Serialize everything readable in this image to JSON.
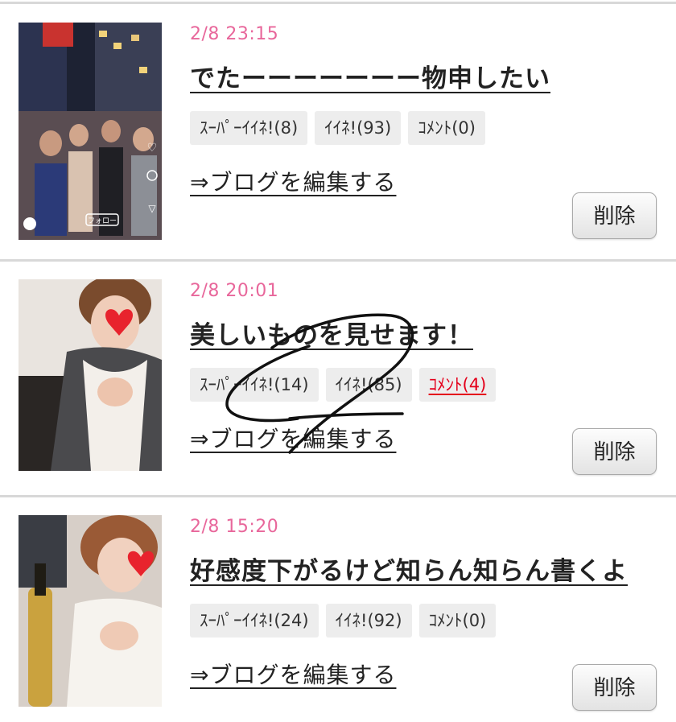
{
  "posts": [
    {
      "date": "2/8 23:15",
      "title": "でたーーーーーーー物申したい",
      "super_like": "ｽｰﾊﾟｰｲｲﾈ!(8)",
      "like": "ｲｲﾈ!(93)",
      "comment": "ｺﾒﾝﾄ(0)",
      "edit_link": "⇒ブログを編集する",
      "delete_label": "削除",
      "thumb_overlay": "フォロー"
    },
    {
      "date": "2/8 20:01",
      "title": "美しいものを見せます！",
      "super_like": "ｽｰﾊﾟｰｲｲﾈ!(14)",
      "like": "ｲｲﾈ!(85)",
      "comment": "ｺﾒﾝﾄ(4)",
      "edit_link": "⇒ブログを編集する",
      "delete_label": "削除"
    },
    {
      "date": "2/8 15:20",
      "title": "好感度下がるけど知らん知らん書くよ",
      "super_like": "ｽｰﾊﾟｰｲｲﾈ!(24)",
      "like": "ｲｲﾈ!(92)",
      "comment": "ｺﾒﾝﾄ(0)",
      "edit_link": "⇒ブログを編集する",
      "delete_label": "削除"
    }
  ],
  "colors": {
    "date": "#e8679b",
    "active_comment": "#e4001b",
    "badge_bg": "#ededed",
    "divider": "#d8d8d8"
  }
}
